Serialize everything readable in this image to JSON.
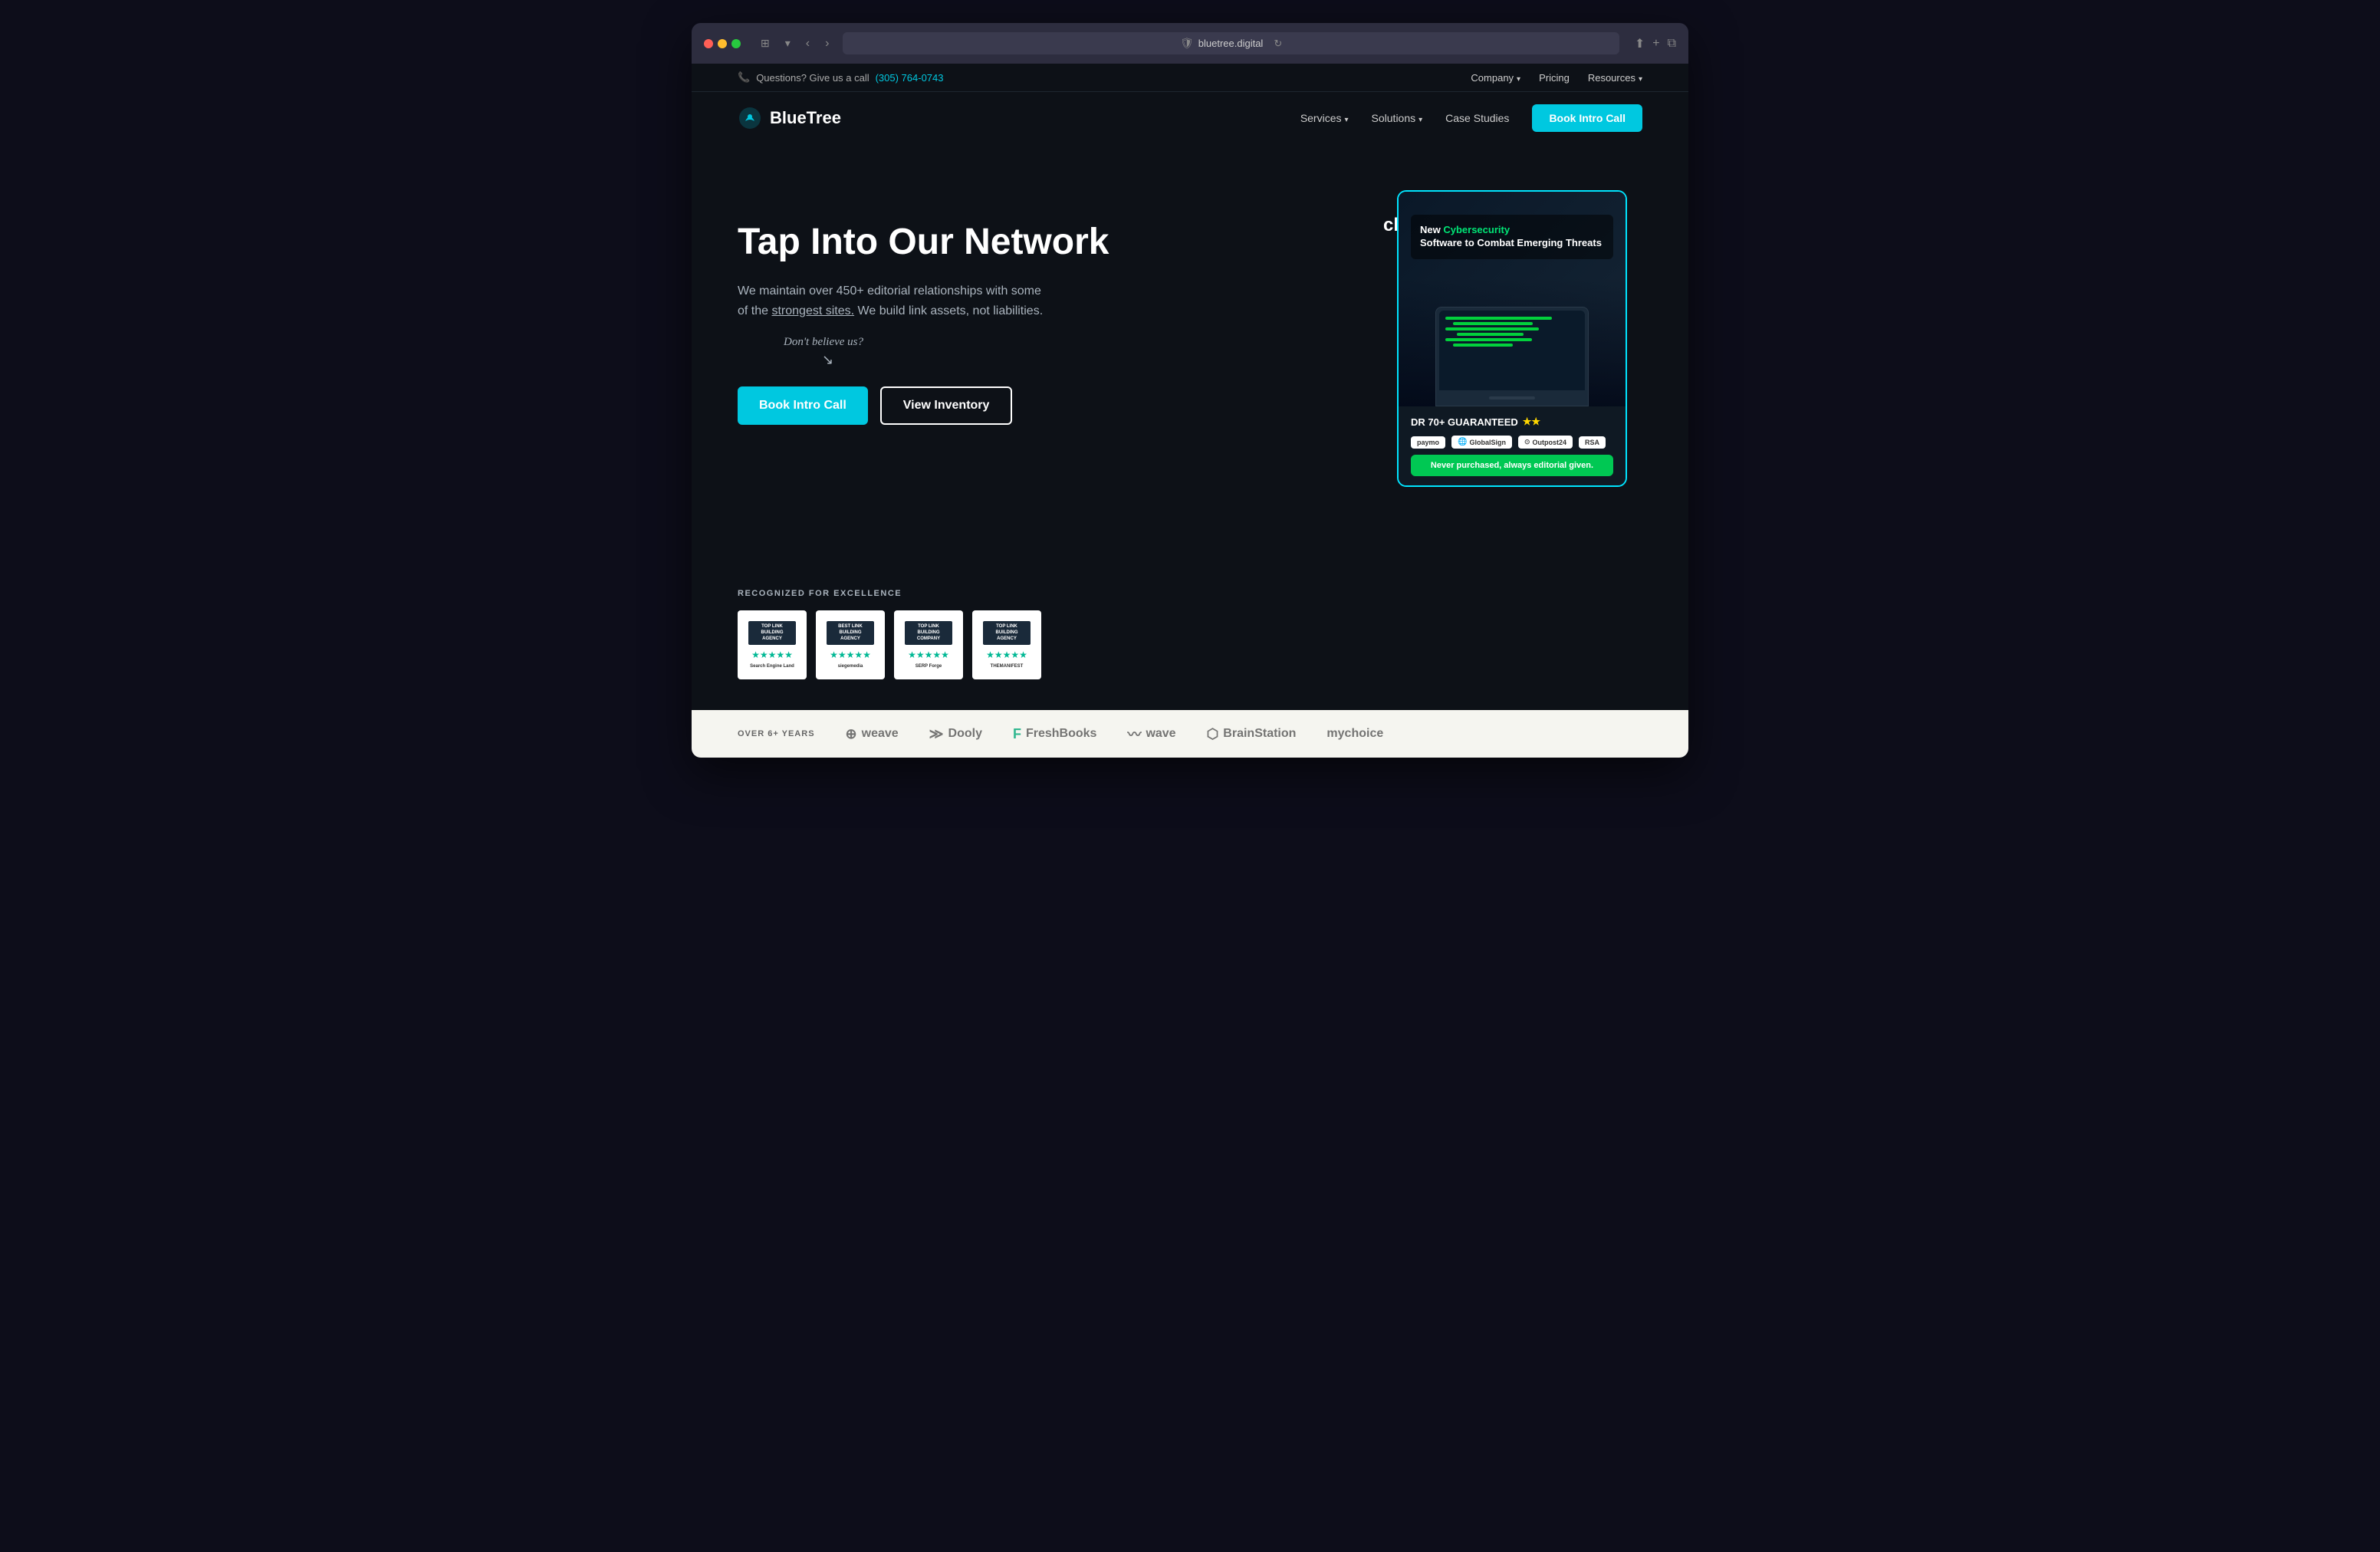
{
  "browser": {
    "url": "bluetree.digital",
    "url_display": "bluetree.digital",
    "nav_back": "‹",
    "nav_forward": "›"
  },
  "topbar": {
    "question_text": "Questions? Give us a call",
    "phone": "(305) 764-0743",
    "nav_items": [
      {
        "label": "Company",
        "has_dropdown": true
      },
      {
        "label": "Pricing",
        "has_dropdown": false
      },
      {
        "label": "Resources",
        "has_dropdown": true
      }
    ]
  },
  "nav": {
    "logo_text": "BlueTree",
    "links": [
      {
        "label": "Services",
        "has_dropdown": true
      },
      {
        "label": "Solutions",
        "has_dropdown": true
      },
      {
        "label": "Case Studies",
        "has_dropdown": false
      }
    ],
    "cta_label": "Book Intro Call"
  },
  "hero": {
    "title": "Tap Into Our Network",
    "subtitle_1": "We maintain over 450+ editorial relationships with some",
    "subtitle_2": "of the",
    "subtitle_link": "strongest sites.",
    "subtitle_3": "We build link assets, not liabilities.",
    "dont_believe": "Don't believe us?",
    "btn_primary": "Book Intro Call",
    "btn_secondary": "View Inventory"
  },
  "awards": {
    "section_label": "RECOGNIZED FOR EXCELLENCE",
    "badges": [
      {
        "line1": "TOP LINK",
        "line2": "BUILDING",
        "line3": "AGENCY",
        "source": "Search Engine Land"
      },
      {
        "line1": "BEST LINK",
        "line2": "BUILDING",
        "line3": "AGENCY",
        "source": "siegemedia"
      },
      {
        "line1": "TOP LINK",
        "line2": "BUILDING",
        "line3": "COMPANY",
        "source": "SERP Forge"
      },
      {
        "line1": "TOP LINK",
        "line2": "BUILDING",
        "line3": "AGENCY",
        "source": "THEMANIFEST"
      }
    ]
  },
  "card": {
    "partial_text": "ch",
    "headline_pre": "New ",
    "headline_highlight": "Cybersecurity",
    "headline_post": " Software to Combat Emerging Threats",
    "dr_badge": "DR 70+ GUARANTEED",
    "editorial_text": "Never purchased, always editorial given.",
    "clients": [
      "paymo",
      "GlobalSign",
      "Outpost24",
      "RSA"
    ]
  },
  "logos_bar": {
    "label": "OVER 6+ YEARS",
    "brands": [
      {
        "name": "weave",
        "icon": "⊕"
      },
      {
        "name": "Dooly",
        "icon": "≫"
      },
      {
        "name": "FreshBooks",
        "icon": "F"
      },
      {
        "name": "wave",
        "icon": "∿"
      },
      {
        "name": "BrainStation",
        "icon": "⬡"
      },
      {
        "name": "mychoice",
        "icon": ""
      }
    ]
  }
}
